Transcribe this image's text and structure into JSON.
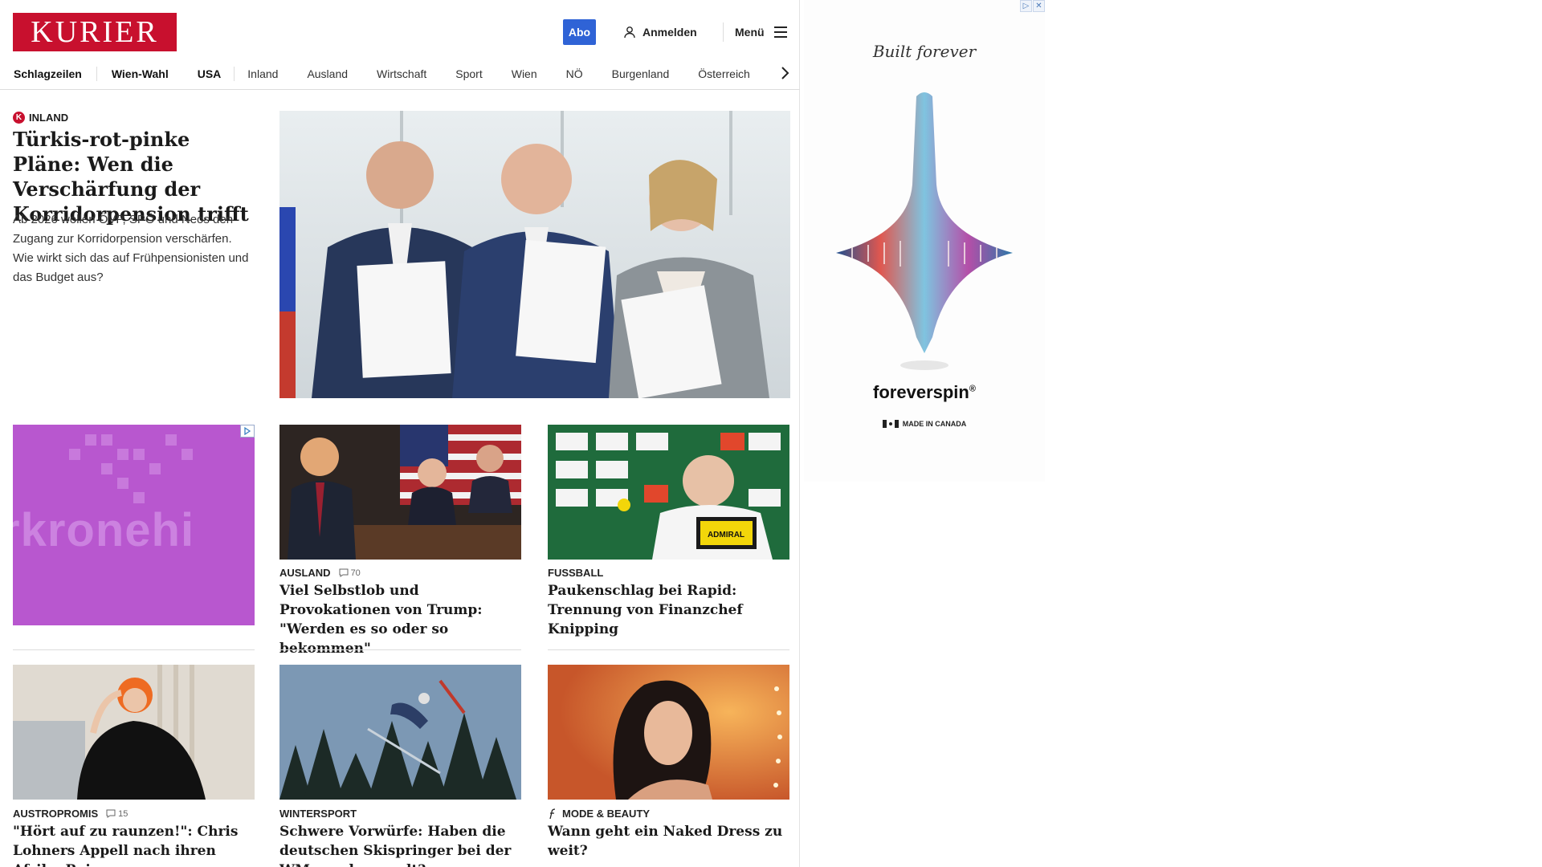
{
  "header": {
    "logo": "KURIER",
    "abo_label": "Abo",
    "login_label": "Anmelden",
    "menu_label": "Menü"
  },
  "nav": {
    "items": [
      "Schlagzeilen",
      "Wien-Wahl",
      "USA",
      "Inland",
      "Ausland",
      "Wirtschaft",
      "Sport",
      "Wien",
      "NÖ",
      "Burgenland",
      "Österreich"
    ]
  },
  "lead": {
    "category": "INLAND",
    "badge": "K",
    "title": "Türkis-rot-pinke Pläne: Wen die Verschärfung der Korridorpension trifft",
    "teaser": "Ab 2026 wollen ÖVP, SPÖ und Neos den Zugang zur Korridorpension verschärfen. Wie wirkt sich das auf Frühpensionisten und das Budget aus?",
    "image_icon": "photo-three-politicians-holding-documents"
  },
  "promo": {
    "word": "rkronehi"
  },
  "cards": [
    {
      "category": "AUSLAND",
      "comments": "70",
      "title": "Viel Selbstlob und Provokationen von Trump: \"Werden es so oder so bekommen\"",
      "image_icon": "photo-trump-speech"
    },
    {
      "category": "FUSSBALL",
      "comments": "",
      "title": "Paukenschlag bei Rapid: Trennung von Finanzchef Knipping",
      "image_icon": "photo-press-conference"
    },
    {
      "category": "AUSTROPROMIS",
      "comments": "15",
      "title": "\"Hört auf zu raunzen!\": Chris Lohners Appell nach ihren Afrika-Reisen",
      "image_icon": "photo-woman-black-dress"
    },
    {
      "category": "WINTERSPORT",
      "comments": "",
      "title": "Schwere Vorwürfe: Haben die deutschen Skispringer bei der WM geschummelt?",
      "image_icon": "photo-ski-jumper"
    },
    {
      "category": "MODE & BEAUTY",
      "comments": "",
      "title": "Wann geht ein Naked Dress zu weit?",
      "image_icon": "photo-woman-portrait"
    }
  ],
  "ad": {
    "script_text": "Built forever",
    "brand": "foreverspin",
    "registered": "®",
    "made_in": "MADE IN CANADA"
  },
  "colors": {
    "brand_red": "#c8102e",
    "abo_blue": "#2f63d6",
    "promo_purple": "#b857cf"
  }
}
